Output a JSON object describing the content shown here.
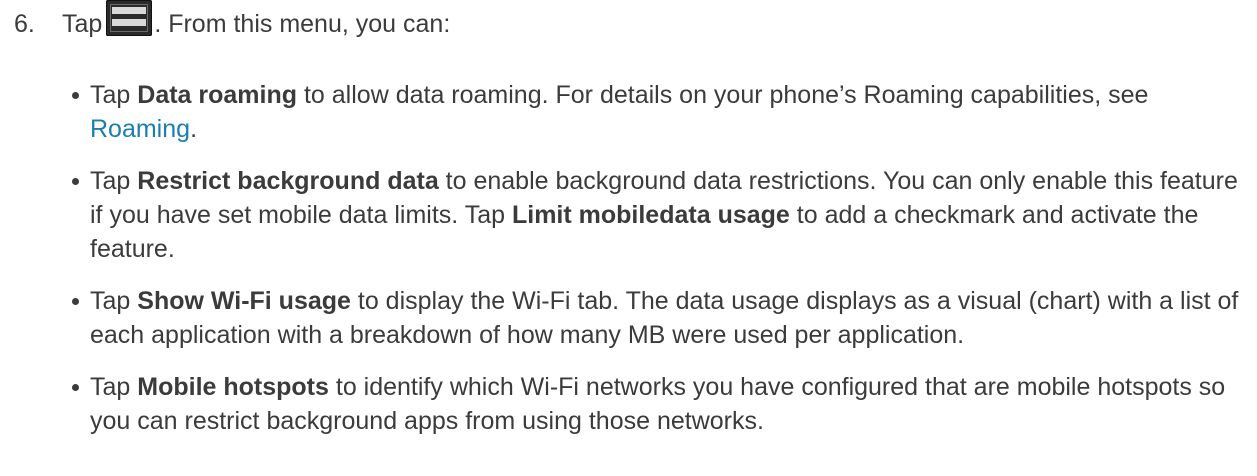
{
  "step": {
    "number": "6.",
    "lead": "Tap",
    "icon": "menu-icon",
    "after": ". From this menu, you can:"
  },
  "items": [
    {
      "pre": "Tap ",
      "bold": "Data roaming",
      "post": " to allow data roaming. For details on your phone’s Roaming capabilities, see ",
      "link": "Roaming",
      "tail": "."
    },
    {
      "pre": "Tap ",
      "bold": "Restrict background data",
      "post": " to enable background data restrictions. You can only enable this feature if you have set mobile data limits. Tap ",
      "bold2": "Limit mobiledata usage",
      "tail": " to add a checkmark and activate the feature."
    },
    {
      "pre": "Tap ",
      "bold": "Show Wi-Fi usage",
      "post": " to display the Wi-Fi tab. The data usage displays as a visual (chart) with a list of each application with a breakdown of how many MB were used per application."
    },
    {
      "pre": "Tap ",
      "bold": "Mobile hotspots",
      "post": " to identify which Wi-Fi networks you have configured that are mobile hotspots so you can restrict background apps from using those networks."
    }
  ],
  "colors": {
    "text": "#3b3b3b",
    "link": "#1a7fb0"
  }
}
